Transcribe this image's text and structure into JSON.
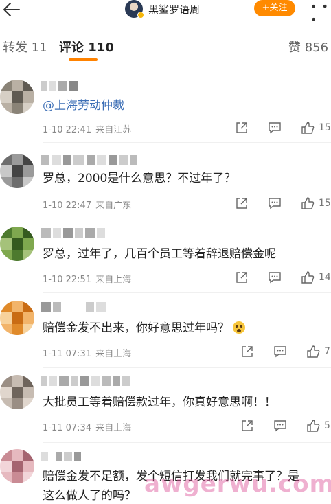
{
  "header": {
    "account_name": "黑鲨罗语周",
    "follow_label": "+关注",
    "more_label": "• • •"
  },
  "tabs": [
    {
      "label": "转发 11"
    },
    {
      "label": "评论 110"
    },
    {
      "label": "赞 856"
    }
  ],
  "comments": [
    {
      "text_mention": "@上海劳动仲裁",
      "text": "",
      "time": "1-10 22:41",
      "location": "来自江苏",
      "likes": "15",
      "avatar_colors": [
        "#8a8377",
        "#b9b0a4",
        "#5f5a52",
        "#d6cfc5"
      ]
    },
    {
      "text_mention": "",
      "text": "罗总，2000是什么意思？不过年了？",
      "time": "1-10 22:47",
      "location": "来自广东",
      "likes": "15",
      "avatar_colors": [
        "#6d6d6d",
        "#9a9a9a",
        "#444444",
        "#c8c8c8"
      ]
    },
    {
      "text_mention": "",
      "text": "罗总，过年了，几百个员工等着辞退赔偿金呢",
      "time": "1-10 22:51",
      "location": "来自上海",
      "likes": "14",
      "avatar_colors": [
        "#4d7a2e",
        "#7fa84f",
        "#355a1f",
        "#a5c27a"
      ]
    },
    {
      "text_mention": "",
      "text": "赔偿金发不出来，你好意思过年吗？",
      "time": "1-11 07:31",
      "location": "来自上海",
      "likes": "7",
      "avatar_colors": [
        "#e08a2a",
        "#f2b46a",
        "#c96c14",
        "#f7d29c"
      ]
    },
    {
      "text_mention": "",
      "text": "大批员工等着赔偿款过年，你真好意思啊！！",
      "time": "1-11 07:34",
      "location": "来自上海",
      "likes": "5",
      "avatar_colors": [
        "#9a8e84",
        "#c7bcb2",
        "#6f655c",
        "#e0d6cd"
      ]
    },
    {
      "text_mention": "",
      "text": "赔偿金发不足额，发个短信打发我们就完事了？是",
      "text2": "这么做人了的吗？",
      "time": "",
      "location": "",
      "likes": "",
      "avatar_colors": [
        "#c98b94",
        "#e6b9bf",
        "#a56470",
        "#f2d5d9"
      ]
    }
  ],
  "watermark": "awgerwu.com"
}
